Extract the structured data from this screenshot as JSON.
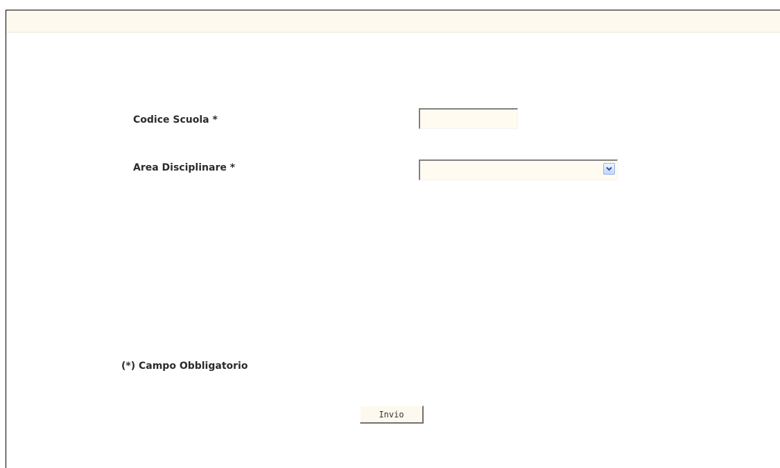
{
  "form": {
    "codice_scuola": {
      "label": "Codice Scuola *",
      "value": ""
    },
    "area_disciplinare": {
      "label": "Area Disciplinare *",
      "selected": ""
    },
    "required_note": "(*) Campo Obbligatorio",
    "submit_label": "Invio"
  },
  "colors": {
    "field_background": "#fffbf0",
    "band_background": "#fdf9ee",
    "dropdown_arrow": "#2a4fa8"
  }
}
